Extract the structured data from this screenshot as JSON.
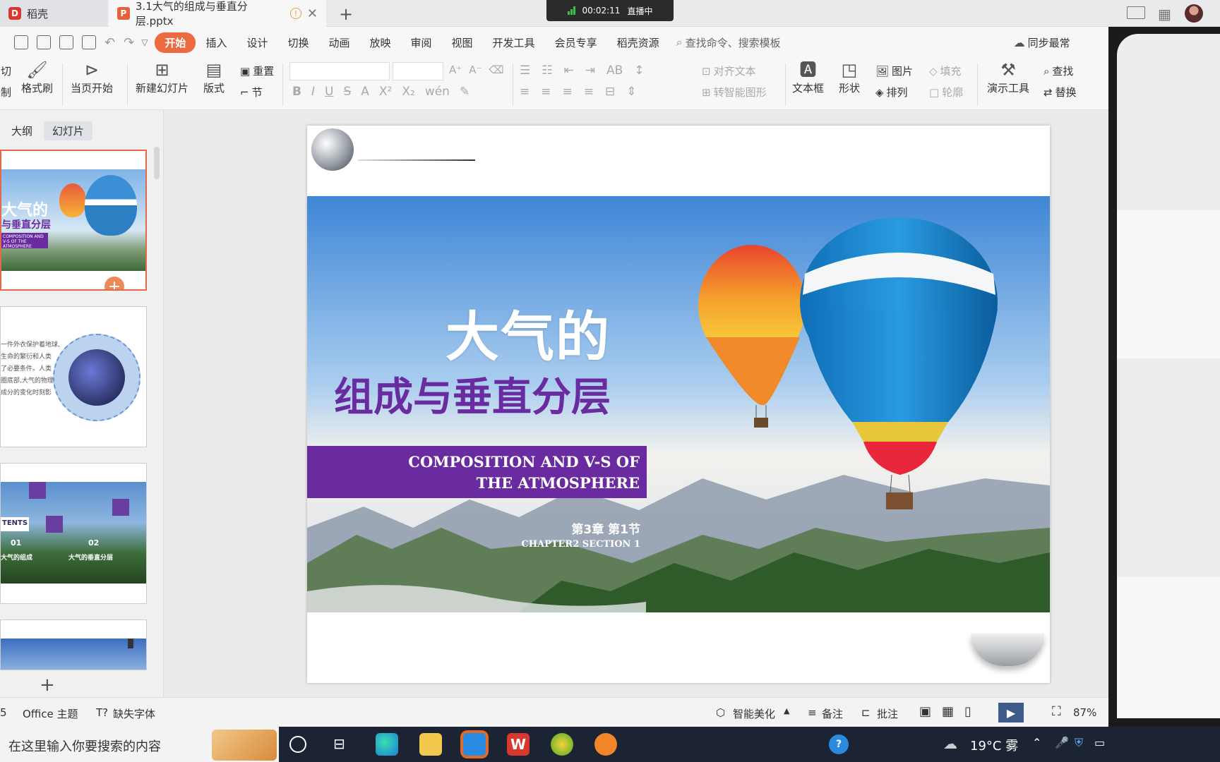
{
  "titlebar": {
    "home_tab": "稻壳",
    "doc_tab": "3.1大气的组成与垂直分层.pptx",
    "live_timer": "00:02:11",
    "live_status": "直播中"
  },
  "menu": {
    "items": [
      "开始",
      "插入",
      "设计",
      "切换",
      "动画",
      "放映",
      "审阅",
      "视图",
      "开发工具",
      "会员专享",
      "稻壳资源"
    ],
    "search_placeholder": "查找命令、搜索模板",
    "sync": "同步最常"
  },
  "ribbon": {
    "cut": "剪切",
    "copy": "复制",
    "format_painter": "格式刷",
    "from_current": "当页开始",
    "new_slide": "新建幻灯片",
    "layout": "版式",
    "reset": "重置",
    "section": "节",
    "align_text": "对齐文本",
    "convert_smartart": "转智能图形",
    "textbox": "文本框",
    "shape": "形状",
    "picture": "图片",
    "fill": "填充",
    "arrange": "排列",
    "outline": "轮廓",
    "present_tools": "演示工具",
    "find": "查找",
    "replace": "替换"
  },
  "panel": {
    "tabs": [
      "大纲",
      "幻灯片"
    ],
    "thumbs": [
      {
        "title_line1": "大气的",
        "title_line2": "与垂直分层",
        "subtitle": "COMPOSITION AND V-S OF THE ATMOSPHERE"
      },
      {
        "text_lines": [
          "一件外衣保护着地球,",
          "生命的繁衍和人类",
          "了必要条件。人类",
          "圈底部,大气的物理",
          "成分的变化时刻影"
        ]
      },
      {
        "contents": "TENTS",
        "n1": "01",
        "n2": "02",
        "l1": "大气的组成",
        "l2": "大气的垂直分层"
      },
      {}
    ]
  },
  "slide": {
    "title_line1": "大气的",
    "title_line2": "组成与垂直分层",
    "banner_line1": "COMPOSITION AND V-S OF",
    "banner_line2": "THE ATMOSPHERE",
    "chapter_cn": "第3章 第1节",
    "chapter_en": "CHAPTER2 SECTION 1"
  },
  "status": {
    "slide_num": "5",
    "theme": "Office 主题",
    "missing_font": "缺失字体",
    "beautify": "智能美化",
    "notes": "备注",
    "comments": "批注",
    "zoom": "87%"
  },
  "taskbar": {
    "search_placeholder": "在这里输入你要搜索的内容",
    "weather": "19°C 雾"
  }
}
